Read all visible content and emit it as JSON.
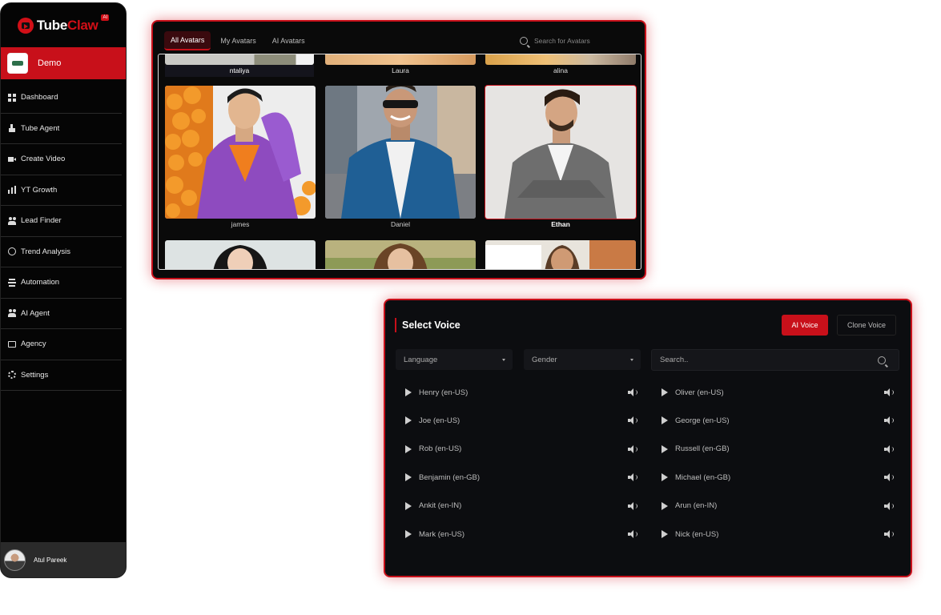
{
  "brand": {
    "name_part1": "Tube",
    "name_part2": "Claw",
    "badge": "AI"
  },
  "workspace": {
    "name": "Demo"
  },
  "sidebar": {
    "items": [
      {
        "label": "Dashboard",
        "icon": "dashboard-grid-icon"
      },
      {
        "label": "Tube Agent",
        "icon": "hand-pointer-icon"
      },
      {
        "label": "Create Video",
        "icon": "video-camera-icon"
      },
      {
        "label": "YT Growth",
        "icon": "bar-chart-icon"
      },
      {
        "label": "Lead Finder",
        "icon": "users-icon"
      },
      {
        "label": "Trend Analysis",
        "icon": "trend-circle-icon"
      },
      {
        "label": "Automation",
        "icon": "layers-icon"
      },
      {
        "label": "AI Agent",
        "icon": "users-icon"
      },
      {
        "label": "Agency",
        "icon": "monitor-icon"
      },
      {
        "label": "Settings",
        "icon": "gear-icon"
      }
    ]
  },
  "user": {
    "name": "Atul Pareek"
  },
  "avatars": {
    "tabs": [
      {
        "label": "All Avatars",
        "active": true
      },
      {
        "label": "My Avatars",
        "active": false
      },
      {
        "label": "AI Avatars",
        "active": false
      }
    ],
    "search_placeholder": "Search for Avatars",
    "top_row": [
      "ntaliya",
      "Laura",
      "alina"
    ],
    "cards": [
      {
        "name": "james",
        "selected": false
      },
      {
        "name": "Daniel",
        "selected": false
      },
      {
        "name": "Ethan",
        "selected": true
      }
    ]
  },
  "voice": {
    "title": "Select Voice",
    "ai_voice_label": "AI Voice",
    "clone_voice_label": "Clone Voice",
    "language_label": "Language",
    "gender_label": "Gender",
    "search_placeholder": "Search..",
    "left_column": [
      "Henry (en-US)",
      "Joe (en-US)",
      "Rob (en-US)",
      "Benjamin (en-GB)",
      "Ankit (en-IN)",
      "Mark (en-US)"
    ],
    "right_column": [
      "Oliver (en-US)",
      "George (en-US)",
      "Russell (en-GB)",
      "Michael (en-GB)",
      "Arun (en-IN)",
      "Nick (en-US)"
    ]
  },
  "colors": {
    "accent": "#c8101a",
    "panel": "#0c0d10",
    "sidebar": "#050505"
  }
}
